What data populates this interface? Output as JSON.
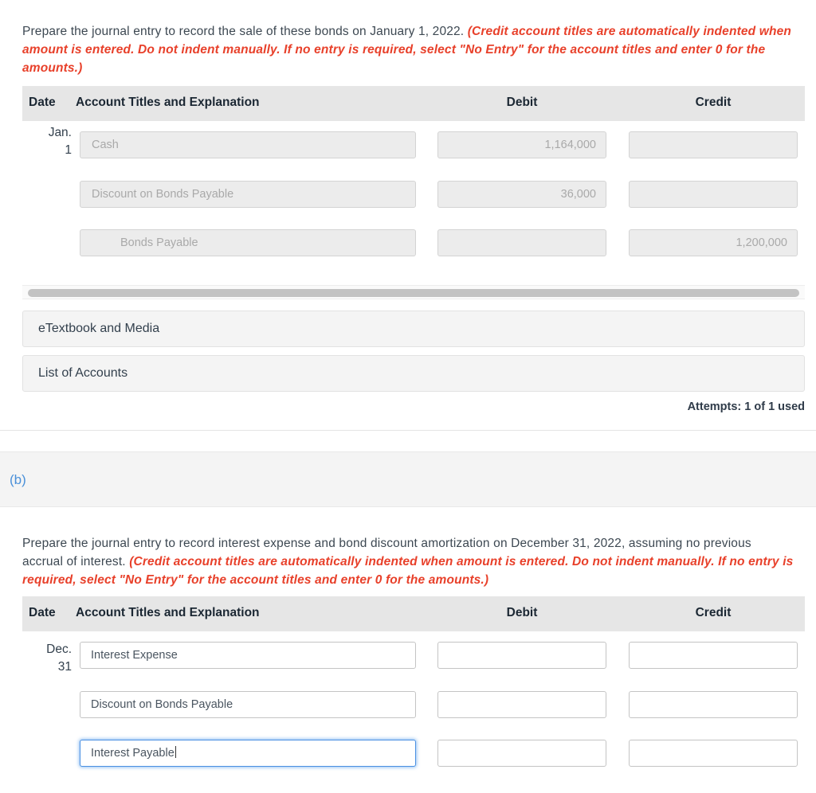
{
  "part_a": {
    "prompt_plain": "Prepare the journal entry to record the sale of these bonds on January 1, 2022. ",
    "prompt_note": "(Credit account titles are automatically indented when amount is entered. Do not indent manually. If no entry is required, select \"No Entry\" for the account titles and enter 0 for the amounts.)",
    "table": {
      "headers": {
        "date": "Date",
        "account": "Account Titles and Explanation",
        "debit": "Debit",
        "credit": "Credit"
      },
      "rows": [
        {
          "date_month": "Jan.",
          "date_day": "1",
          "account": "Cash",
          "indented": false,
          "debit": "1,164,000",
          "credit": ""
        },
        {
          "date_month": "",
          "date_day": "",
          "account": "Discount on Bonds Payable",
          "indented": false,
          "debit": "36,000",
          "credit": ""
        },
        {
          "date_month": "",
          "date_day": "",
          "account": "Bonds Payable",
          "indented": true,
          "debit": "",
          "credit": "1,200,000"
        }
      ]
    },
    "etextbook_button": "eTextbook and Media",
    "list_of_accounts_button": "List of Accounts",
    "attempts": "Attempts: 1 of 1 used"
  },
  "part_b": {
    "label": "(b)",
    "prompt_plain": "Prepare the journal entry to record interest expense and bond discount amortization on December 31, 2022, assuming no previous accrual of interest. ",
    "prompt_note": "(Credit account titles are automatically indented when amount is entered. Do not indent manually. If no entry is required, select \"No Entry\" for the account titles and enter 0 for the amounts.)",
    "table": {
      "headers": {
        "date": "Date",
        "account": "Account Titles and Explanation",
        "debit": "Debit",
        "credit": "Credit"
      },
      "rows": [
        {
          "date_month": "Dec.",
          "date_day": "31",
          "account": "Interest Expense",
          "focused": false,
          "debit": "",
          "credit": ""
        },
        {
          "date_month": "",
          "date_day": "",
          "account": "Discount on Bonds Payable",
          "focused": false,
          "debit": "",
          "credit": ""
        },
        {
          "date_month": "",
          "date_day": "",
          "account": "Interest Payable",
          "focused": true,
          "debit": "",
          "credit": ""
        }
      ]
    }
  },
  "colors": {
    "note_red": "#e8402a",
    "part_label_blue": "#4a90d9",
    "focus_blue": "#4a90e2",
    "header_gray": "#e6e6e6"
  }
}
